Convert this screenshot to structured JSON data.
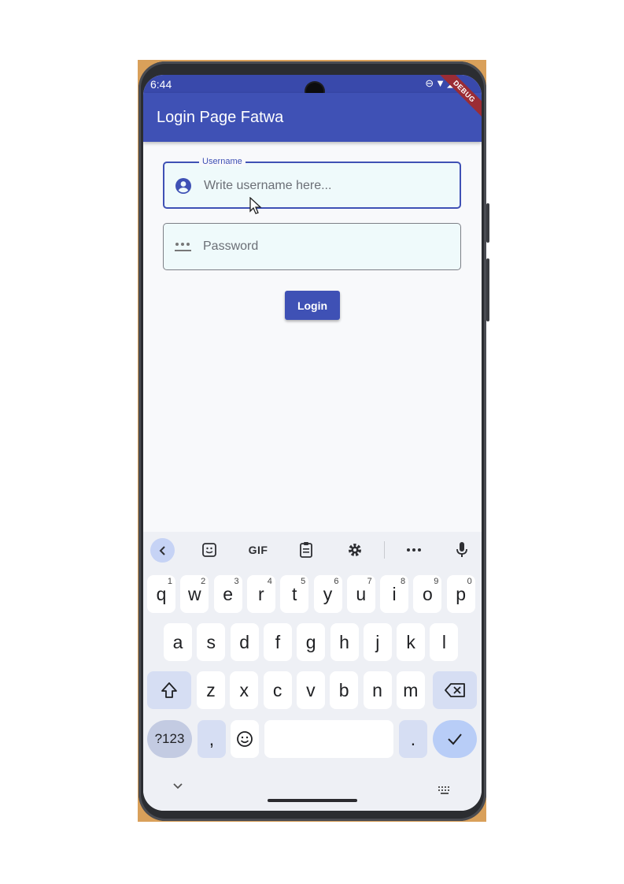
{
  "status_bar": {
    "time": "6:44",
    "debug_banner": "DEBUG"
  },
  "app_bar": {
    "title": "Login Page Fatwa"
  },
  "form": {
    "username": {
      "label": "Username",
      "placeholder": "Write username here..."
    },
    "password": {
      "placeholder": "Password"
    },
    "login_label": "Login"
  },
  "keyboard": {
    "toolbar": {
      "gif_label": "GIF"
    },
    "row1": [
      {
        "key": "q",
        "hint": "1"
      },
      {
        "key": "w",
        "hint": "2"
      },
      {
        "key": "e",
        "hint": "3"
      },
      {
        "key": "r",
        "hint": "4"
      },
      {
        "key": "t",
        "hint": "5"
      },
      {
        "key": "y",
        "hint": "6"
      },
      {
        "key": "u",
        "hint": "7"
      },
      {
        "key": "i",
        "hint": "8"
      },
      {
        "key": "o",
        "hint": "9"
      },
      {
        "key": "p",
        "hint": "0"
      }
    ],
    "row2": [
      "a",
      "s",
      "d",
      "f",
      "g",
      "h",
      "j",
      "k",
      "l"
    ],
    "row3": [
      "z",
      "x",
      "c",
      "v",
      "b",
      "n",
      "m"
    ],
    "sym_label": "?123",
    "comma_label": ",",
    "period_label": "."
  },
  "colors": {
    "primary": "#3f51b5",
    "field_fill": "#effafb",
    "debug": "#9b2c35"
  }
}
